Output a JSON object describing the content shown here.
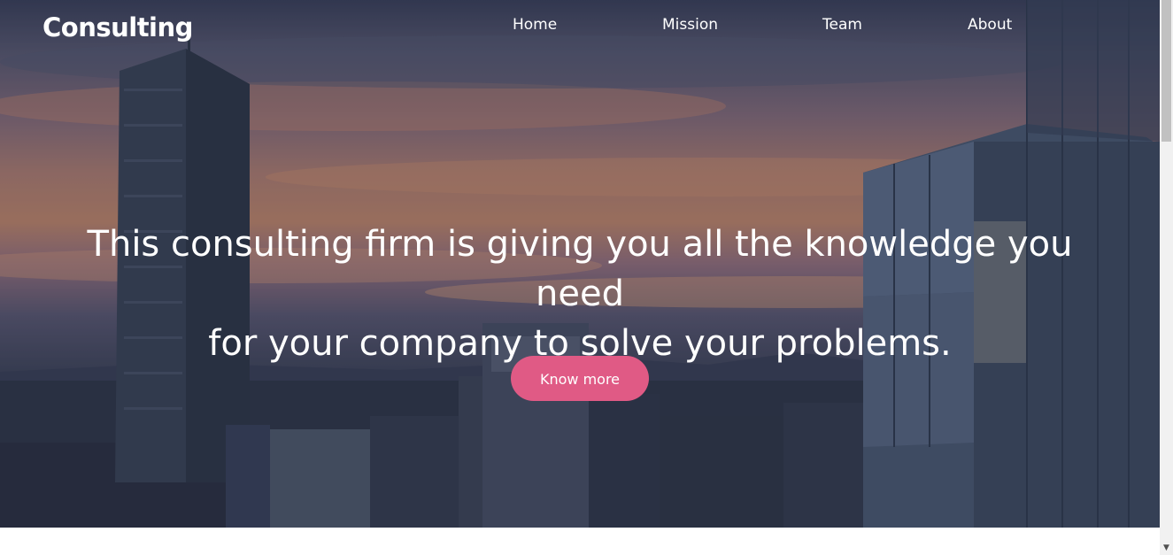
{
  "brand": {
    "logo_text": "Consulting"
  },
  "nav": {
    "items": [
      {
        "label": "Home"
      },
      {
        "label": "Mission"
      },
      {
        "label": "Team"
      },
      {
        "label": "About"
      }
    ]
  },
  "hero": {
    "headline_line1": "This consulting firm is giving you all the knowledge you need",
    "headline_line2": "for your company to solve your problems.",
    "cta_label": "Know more",
    "background_image": "city-skyline-sunset-photo"
  },
  "colors": {
    "cta": "#e05a85",
    "text": "#ffffff"
  },
  "scrollbar": {
    "arrow_icon": "chevron-down-icon"
  }
}
